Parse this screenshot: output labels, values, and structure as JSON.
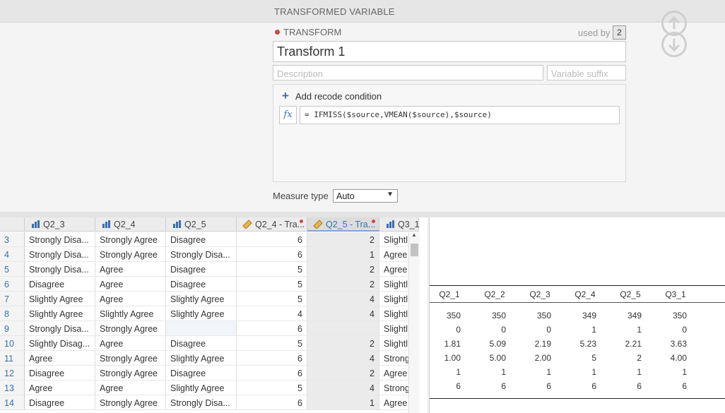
{
  "window": {
    "title": "TRANSFORMED VARIABLE"
  },
  "transform": {
    "type_label": "TRANSFORM",
    "used_by_label": "used by",
    "used_by_count": "2",
    "name_value": "Transform 1",
    "description_placeholder": "Description",
    "suffix_placeholder": "Variable suffix",
    "add_condition_label": "Add recode condition",
    "fx_label": "fx",
    "formula": "= IFMISS($source,VMEAN($source),$source)",
    "measure_type_label": "Measure type",
    "measure_type_value": "Auto"
  },
  "grid": {
    "columns": [
      "Q2_3",
      "Q2_4",
      "Q2_5",
      "Q2_4 - Tra...",
      "Q2_5 - Tra...",
      "Q3_1"
    ],
    "rows": [
      {
        "n": "3",
        "c0": "Strongly Disa...",
        "c1": "Strongly Agree",
        "c2": "Disagree",
        "c3": "6",
        "c4": "2",
        "c5": "Slightl"
      },
      {
        "n": "4",
        "c0": "Strongly Disa...",
        "c1": "Strongly Agree",
        "c2": "Strongly Disa...",
        "c3": "6",
        "c4": "1",
        "c5": "Agree"
      },
      {
        "n": "5",
        "c0": "Strongly Disa...",
        "c1": "Agree",
        "c2": "Disagree",
        "c3": "5",
        "c4": "2",
        "c5": "Agree"
      },
      {
        "n": "6",
        "c0": "Disagree",
        "c1": "Agree",
        "c2": "Disagree",
        "c3": "5",
        "c4": "2",
        "c5": "Slightl"
      },
      {
        "n": "7",
        "c0": "Slightly Agree",
        "c1": "Agree",
        "c2": "Slightly Agree",
        "c3": "5",
        "c4": "4",
        "c5": "Slightl"
      },
      {
        "n": "8",
        "c0": "Slightly Agree",
        "c1": "Slightly Agree",
        "c2": "Slightly Agree",
        "c3": "4",
        "c4": "4",
        "c5": "Slightl"
      },
      {
        "n": "9",
        "c0": "Strongly Disa...",
        "c1": "Strongly Agree",
        "c2": "",
        "c3": "6",
        "c4": "",
        "c5": "Slightl"
      },
      {
        "n": "10",
        "c0": "Slightly Disag...",
        "c1": "Agree",
        "c2": "Disagree",
        "c3": "5",
        "c4": "2",
        "c5": "Slightl"
      },
      {
        "n": "11",
        "c0": "Agree",
        "c1": "Strongly Agree",
        "c2": "Slightly Agree",
        "c3": "6",
        "c4": "4",
        "c5": "Strong"
      },
      {
        "n": "12",
        "c0": "Disagree",
        "c1": "Strongly Agree",
        "c2": "Disagree",
        "c3": "6",
        "c4": "2",
        "c5": "Agree"
      },
      {
        "n": "13",
        "c0": "Agree",
        "c1": "Agree",
        "c2": "Slightly Agree",
        "c3": "5",
        "c4": "4",
        "c5": "Strong"
      },
      {
        "n": "14",
        "c0": "Disagree",
        "c1": "Strongly Agree",
        "c2": "Strongly Disa...",
        "c3": "6",
        "c4": "1",
        "c5": "Agree"
      }
    ]
  },
  "output": {
    "headers": [
      "Q2_1",
      "Q2_2",
      "Q2_3",
      "Q2_4",
      "Q2_5",
      "Q3_1"
    ],
    "rows": [
      [
        "350",
        "350",
        "350",
        "349",
        "349",
        "350"
      ],
      [
        "0",
        "0",
        "0",
        "1",
        "1",
        "0"
      ],
      [
        "1.81",
        "5.09",
        "2.19",
        "5.23",
        "2.21",
        "3.63"
      ],
      [
        "1.00",
        "5.00",
        "2.00",
        "5",
        "2",
        "4.00"
      ],
      [
        "1",
        "1",
        "1",
        "1",
        "1",
        "1"
      ],
      [
        "6",
        "6",
        "6",
        "6",
        "6",
        "6"
      ]
    ]
  },
  "icons": {
    "nominal": "bar-chart-icon",
    "computed": "ruler-icon",
    "up": "arrow-up-circle-icon",
    "down": "arrow-down-circle-icon",
    "plus": "plus-icon"
  },
  "colors": {
    "accent": "#3a6fb0",
    "dot": "#c84a44"
  }
}
